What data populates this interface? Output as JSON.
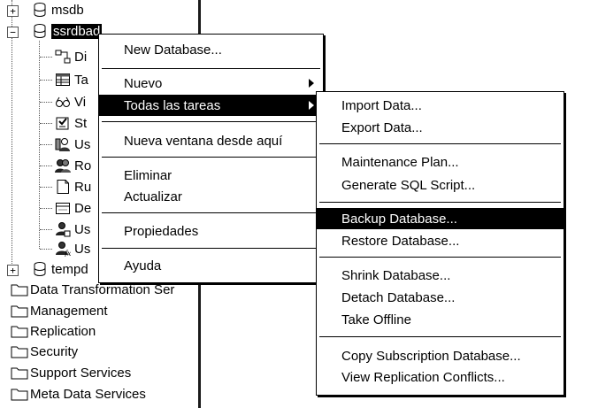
{
  "tree": {
    "items": [
      {
        "label": "msdb",
        "icon": "database-icon"
      },
      {
        "label": "ssrdbad",
        "icon": "database-icon"
      },
      {
        "label": "Di",
        "icon": "diagram-icon"
      },
      {
        "label": "Ta",
        "icon": "table-icon"
      },
      {
        "label": "Vi",
        "icon": "view-icon"
      },
      {
        "label": "St",
        "icon": "stored-procedure-icon"
      },
      {
        "label": "Us",
        "icon": "users-icon"
      },
      {
        "label": "Ro",
        "icon": "roles-icon"
      },
      {
        "label": "Ru",
        "icon": "rules-icon"
      },
      {
        "label": "De",
        "icon": "defaults-icon"
      },
      {
        "label": "Us",
        "icon": "user-types-icon"
      },
      {
        "label": "Us",
        "icon": "user-functions-icon"
      },
      {
        "label": "tempd",
        "icon": "database-icon"
      },
      {
        "label": "Data Transformation Ser",
        "icon": "folder-icon"
      },
      {
        "label": "Management",
        "icon": "folder-icon"
      },
      {
        "label": "Replication",
        "icon": "folder-icon"
      },
      {
        "label": "Security",
        "icon": "folder-icon"
      },
      {
        "label": "Support Services",
        "icon": "folder-icon"
      },
      {
        "label": "Meta Data Services",
        "icon": "folder-icon"
      }
    ]
  },
  "context_menu": {
    "items": [
      {
        "label": "New Database..."
      },
      {
        "label": "Nuevo"
      },
      {
        "label": "Todas las tareas"
      },
      {
        "label": "Nueva ventana desde aquí"
      },
      {
        "label": "Eliminar"
      },
      {
        "label": "Actualizar"
      },
      {
        "label": "Propiedades"
      },
      {
        "label": "Ayuda"
      }
    ]
  },
  "submenu": {
    "items": [
      {
        "label": "Import Data..."
      },
      {
        "label": "Export Data..."
      },
      {
        "label": "Maintenance Plan..."
      },
      {
        "label": "Generate SQL Script..."
      },
      {
        "label": "Backup Database..."
      },
      {
        "label": "Restore Database..."
      },
      {
        "label": "Shrink Database..."
      },
      {
        "label": "Detach Database..."
      },
      {
        "label": "Take Offline"
      },
      {
        "label": "Copy Subscription Database..."
      },
      {
        "label": "View Replication Conflicts..."
      }
    ]
  },
  "colors": {
    "highlight": "#000000",
    "highlight_text": "#ffffff",
    "background": "#ffffff"
  }
}
